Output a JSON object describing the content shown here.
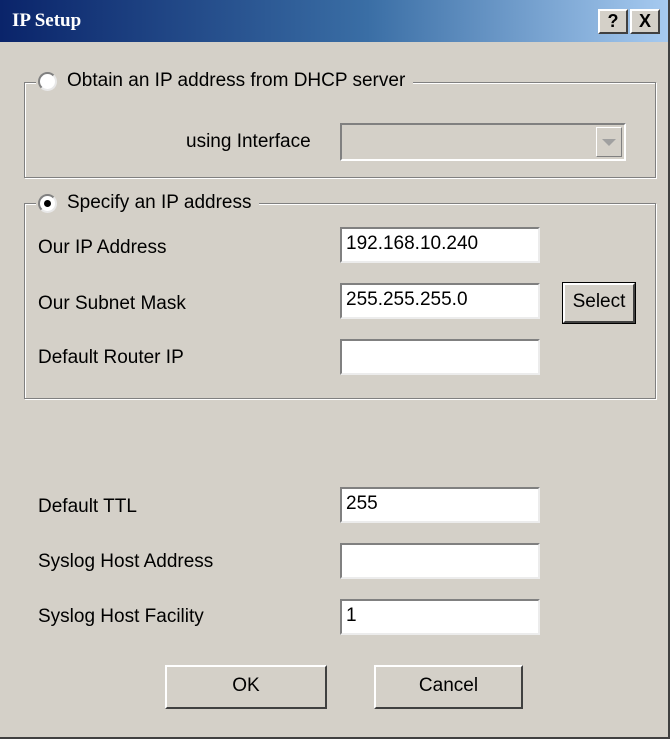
{
  "window": {
    "title": "IP Setup",
    "help_label": "?",
    "close_label": "X"
  },
  "dhcp": {
    "option_label": "Obtain an IP address from DHCP server",
    "selected": false,
    "interface_label": "using Interface",
    "interface_value": ""
  },
  "static": {
    "option_label": "Specify an IP address",
    "selected": true,
    "ip_label": "Our IP Address",
    "ip_value": "192.168.10.240",
    "mask_label": "Our Subnet Mask",
    "mask_value": "255.255.255.0",
    "select_label": "Select",
    "router_label": "Default Router IP",
    "router_value": ""
  },
  "misc": {
    "ttl_label": "Default TTL",
    "ttl_value": "255",
    "syslog_addr_label": "Syslog Host Address",
    "syslog_addr_value": "",
    "syslog_fac_label": "Syslog Host Facility",
    "syslog_fac_value": "1"
  },
  "buttons": {
    "ok_label": "OK",
    "cancel_label": "Cancel"
  },
  "colors": {
    "title_start": "#0a246a",
    "title_end": "#a6caf0",
    "face": "#d4d0c8"
  }
}
